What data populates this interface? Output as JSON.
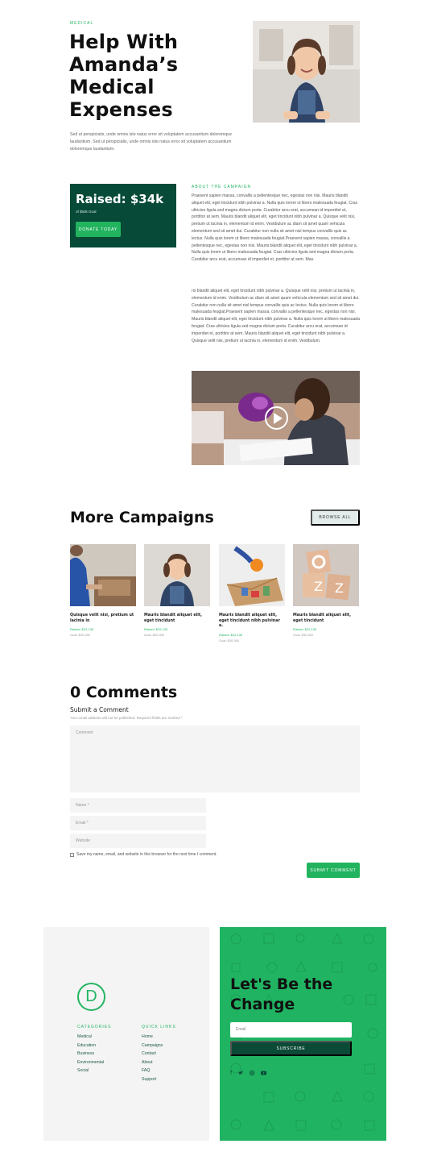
{
  "hero": {
    "eyebrow": "MEDICAL",
    "title_line1": "Help With",
    "title_line2": "Amanda’s",
    "title_line3": "Medical",
    "title_line4": "Expenses",
    "description": "Sed ut perspiciatis, unde omnis iste natus error sit voluptatem accusantium doloremque laudantium. Sed ut perspiciatis, unde omnis iste natus error sit voluptatem accusantium doloremque laudantium."
  },
  "campaign": {
    "raised_label": "Raised: $34k",
    "goal_label": "of $50k Goal",
    "donate_button": "DONATE TODAY",
    "about_heading": "ABOUT THE CAMPAIGN",
    "paragraph1": "Praesent sapien massa, convallis a pellentesque nec, egestas non nisi. Mauris blandit aliquet elit, eget tincidunt nibh pulvinar a. Nulla quis lorem ut libero malesuada feugiat. Cras ultricies ligula sed magna dictum porta. Curabitur arcu erat, accumsan id imperdiet et, porttitor at sem. Mauris blandit aliquet elit, eget tincidunt nibh pulvinar a. Quisque velit nisi, pretium ut lacinia in, elementum id enim. Vestibulum ac diam sit amet quam vehicula elementum sed sit amet dui. Curabitur non nulla sit amet nisl tempus convallis quis ac lectus. Nulla quis lorem ut libero malesuada feugiat.Praesent sapien massa, convallis a pellentesque nec, egestas non nisi. Mauris blandit aliquet elit, eget tincidunt nibh pulvinar a. Nulla quis lorem ut libero malesuada feugiat. Cras ultricies ligula sed magna dictum porta. Curabitur arcu erat, accumsan id imperdiet et, porttitor at sem. Mau",
    "paragraph2": "ris blandit aliquet elit, eget tincidunt nibh pulvinar a. Quisque velit nisi, pretium ut lacinia in, elementum id enim. Vestibulum ac diam sit amet quam vehicula elementum sed sit amet dui. Curabitur non nulla sit amet nisl tempus convallis quis ac lectus. Nulla quis lorem ut libero malesuada feugiat.Praesent sapien massa, convallis a pellentesque nec, egestas non nisi. Mauris blandit aliquet elit, eget tincidunt nibh pulvinar a. Nulla quis lorem ut libero malesuada feugiat. Cras ultricies ligula sed magna dictum porta. Curabitur arcu erat, accumsan id imperdiet et, porttitor at sem. Mauris blandit aliquet elit, eget tincidunt nibh pulvinar a. Quisque velit nisi, pretium ut lacinia in, elementum id enim. Vestibulum."
  },
  "more_campaigns": {
    "title": "More Campaigns",
    "browse_button": "BROWSE ALL",
    "cards": [
      {
        "title": "Quisque velit nisi, pretium ut lacinia in",
        "raised": "Raised: $22,135",
        "goal": "Goal: $30,000"
      },
      {
        "title": "Mauris blandit aliquet elit, eget tincidunt",
        "raised": "Raised: $22,135",
        "goal": "Goal: $30,000"
      },
      {
        "title": "Mauris blandit aliquet elit, eget tincidunt nibh pulvinar a.",
        "raised": "Raised: $22,135",
        "goal": "Goal: $30,000"
      },
      {
        "title": "Mauris blandit aliquet elit, eget tincidunt",
        "raised": "Raised: $22,135",
        "goal": "Goal: $30,000"
      }
    ]
  },
  "comments": {
    "title": "0 Comments",
    "submit_heading": "Submit a Comment",
    "note": "Your email address will not be published. Required fields are marked *",
    "comment_placeholder": "Comment",
    "name_placeholder": "Name *",
    "email_placeholder": "Email *",
    "website_placeholder": "Website",
    "save_label": "Save my name, email, and website in this browser for the next time I comment.",
    "submit_button": "SUBMIT COMMENT"
  },
  "footer": {
    "logo_letter": "D",
    "categories_title": "CATEGORIES",
    "categories": [
      "Medical",
      "Education",
      "Business",
      "Environmental",
      "Social"
    ],
    "quicklinks_title": "QUICK LINKS",
    "quicklinks": [
      "Home",
      "Campaigns",
      "Contact",
      "About",
      "FAQ",
      "Support"
    ],
    "cta_line1": "Let's Be the",
    "cta_line2": "Change",
    "email_placeholder": "Email",
    "subscribe_button": "SUBSCRIBE",
    "social_icons": [
      "facebook-icon",
      "twitter-icon",
      "instagram-icon",
      "youtube-icon"
    ]
  },
  "colors": {
    "accent_green": "#23b562",
    "dark_green": "#064a37",
    "footer_gray": "#f4f4f4"
  }
}
